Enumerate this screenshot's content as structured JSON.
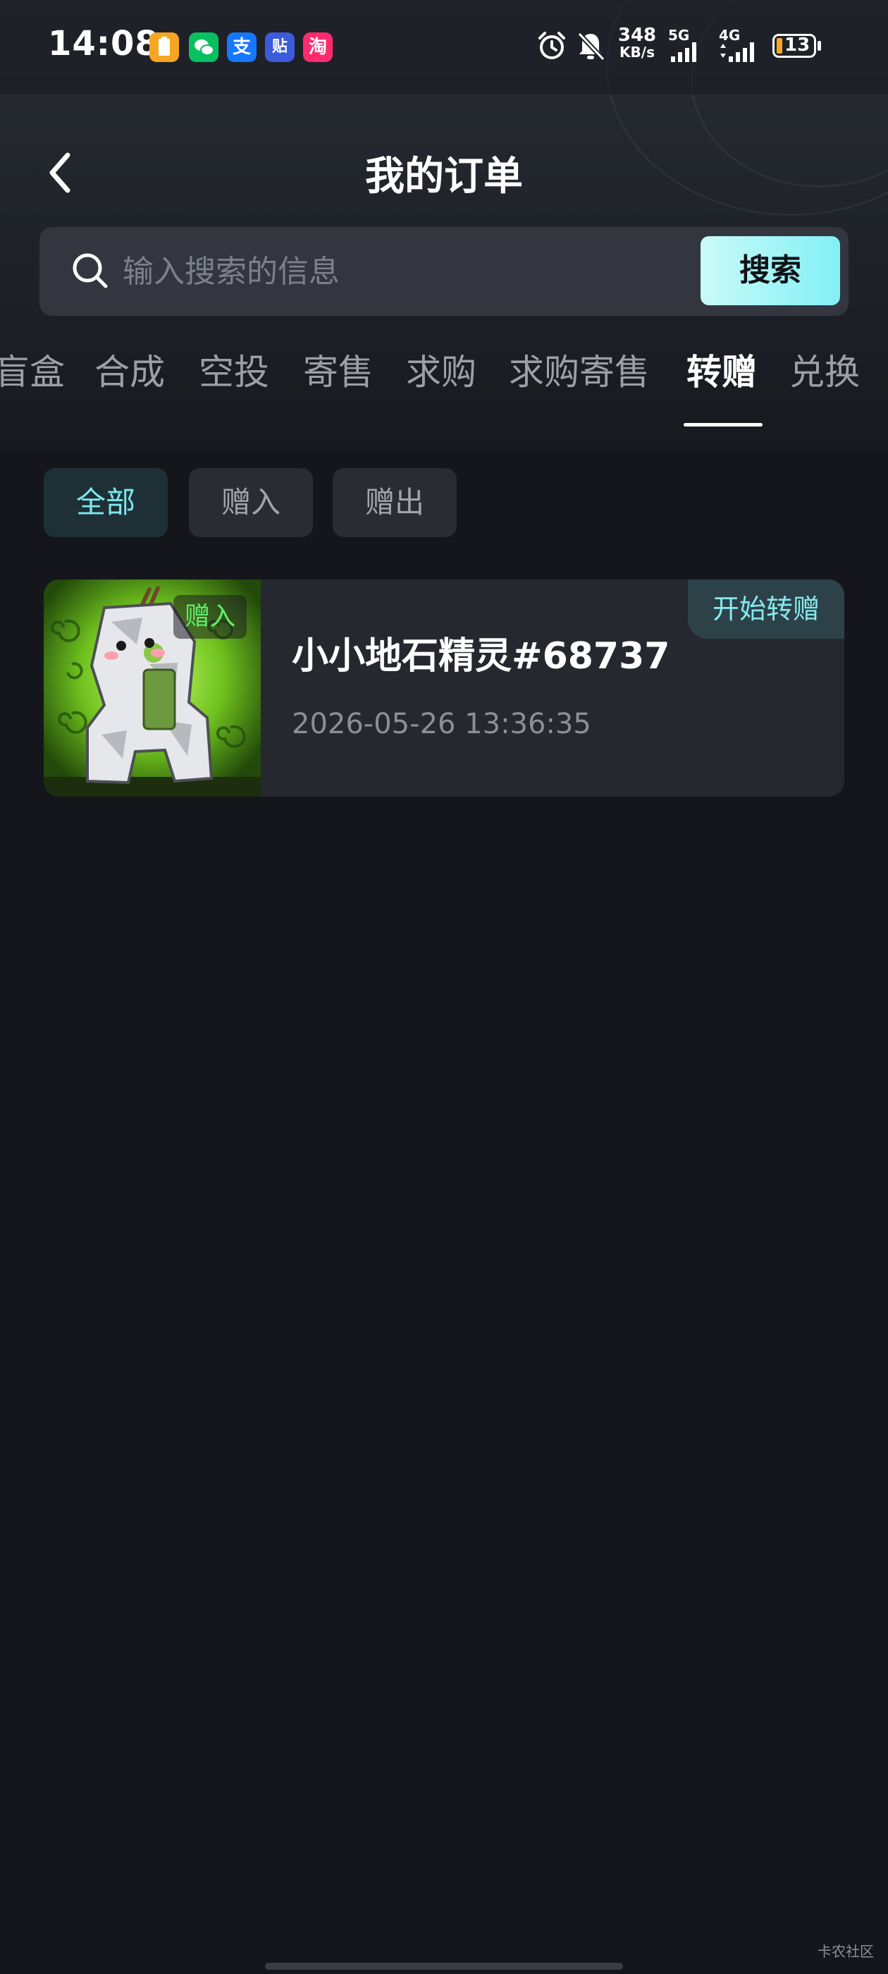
{
  "status_bar": {
    "time": "14:08",
    "app_icons": [
      {
        "name": "clipboard-app-icon",
        "glyph": "▮",
        "color": "#f5a623"
      },
      {
        "name": "wechat-icon",
        "glyph": "◉",
        "color": "#07c160"
      },
      {
        "name": "alipay-icon",
        "glyph": "支",
        "color": "#1677ff"
      },
      {
        "name": "tieba-icon",
        "glyph": "贴",
        "color": "#3b5bdb"
      },
      {
        "name": "taobao-icon",
        "glyph": "淘",
        "color": "#ff2b6e"
      }
    ],
    "net_speed_value": "348",
    "net_speed_unit": "KB/s",
    "sim1_label": "5G",
    "sim2_label": "4G",
    "battery": "13"
  },
  "header": {
    "title": "我的订单"
  },
  "search": {
    "placeholder": "输入搜索的信息",
    "button_label": "搜索"
  },
  "tabs": [
    {
      "label": "盲盒",
      "active": false
    },
    {
      "label": "合成",
      "active": false
    },
    {
      "label": "空投",
      "active": false
    },
    {
      "label": "寄售",
      "active": false
    },
    {
      "label": "求购",
      "active": false
    },
    {
      "label": "求购寄售",
      "active": false
    },
    {
      "label": "转赠",
      "active": true
    },
    {
      "label": "兑换",
      "active": false
    }
  ],
  "filters": [
    {
      "label": "全部",
      "active": true
    },
    {
      "label": "赠入",
      "active": false
    },
    {
      "label": "赠出",
      "active": false
    }
  ],
  "orders": [
    {
      "badge": "赠入",
      "title": "小小地石精灵#68737",
      "date": "2026-05-26 13:36:35",
      "action": "开始转赠"
    }
  ],
  "watermark": "卡农社区",
  "colors": {
    "background": "#14161c",
    "accent": "#7ee8ef",
    "search_button": "#82f0f6",
    "badge_green": "#5ff06a"
  }
}
